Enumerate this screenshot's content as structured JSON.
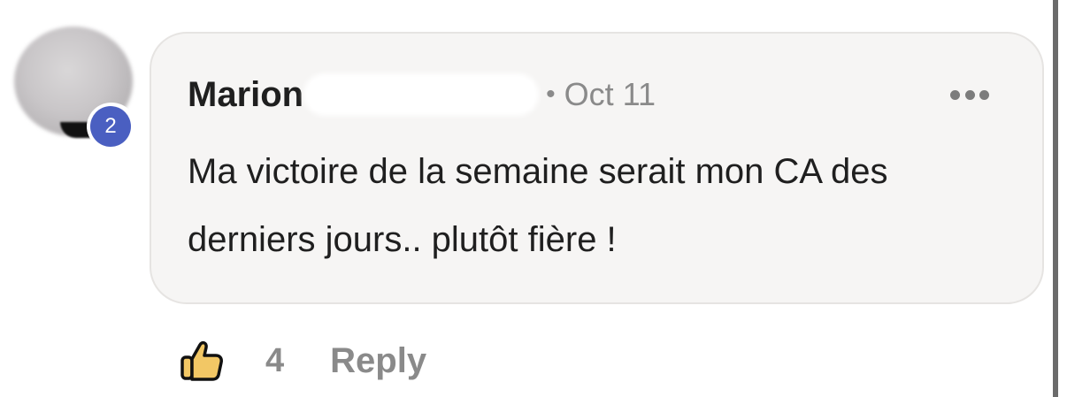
{
  "avatar": {
    "badge_count": "2",
    "badge_color": "#4a5fc1"
  },
  "comment": {
    "author_name": "Marion",
    "separator": "•",
    "timestamp": "Oct 11",
    "more_icon": "more-horizontal-icon",
    "text": "Ma victoire de la semaine serait mon CA des derniers jours.. plutôt fière !"
  },
  "actions": {
    "like_icon": "thumbs-up-icon",
    "like_count": "4",
    "reply_label": "Reply"
  },
  "colors": {
    "bubble_bg": "#f6f5f4",
    "text_primary": "#1f1f1f",
    "text_secondary": "#8a8a8a",
    "thumb_fill": "#f2c765"
  }
}
